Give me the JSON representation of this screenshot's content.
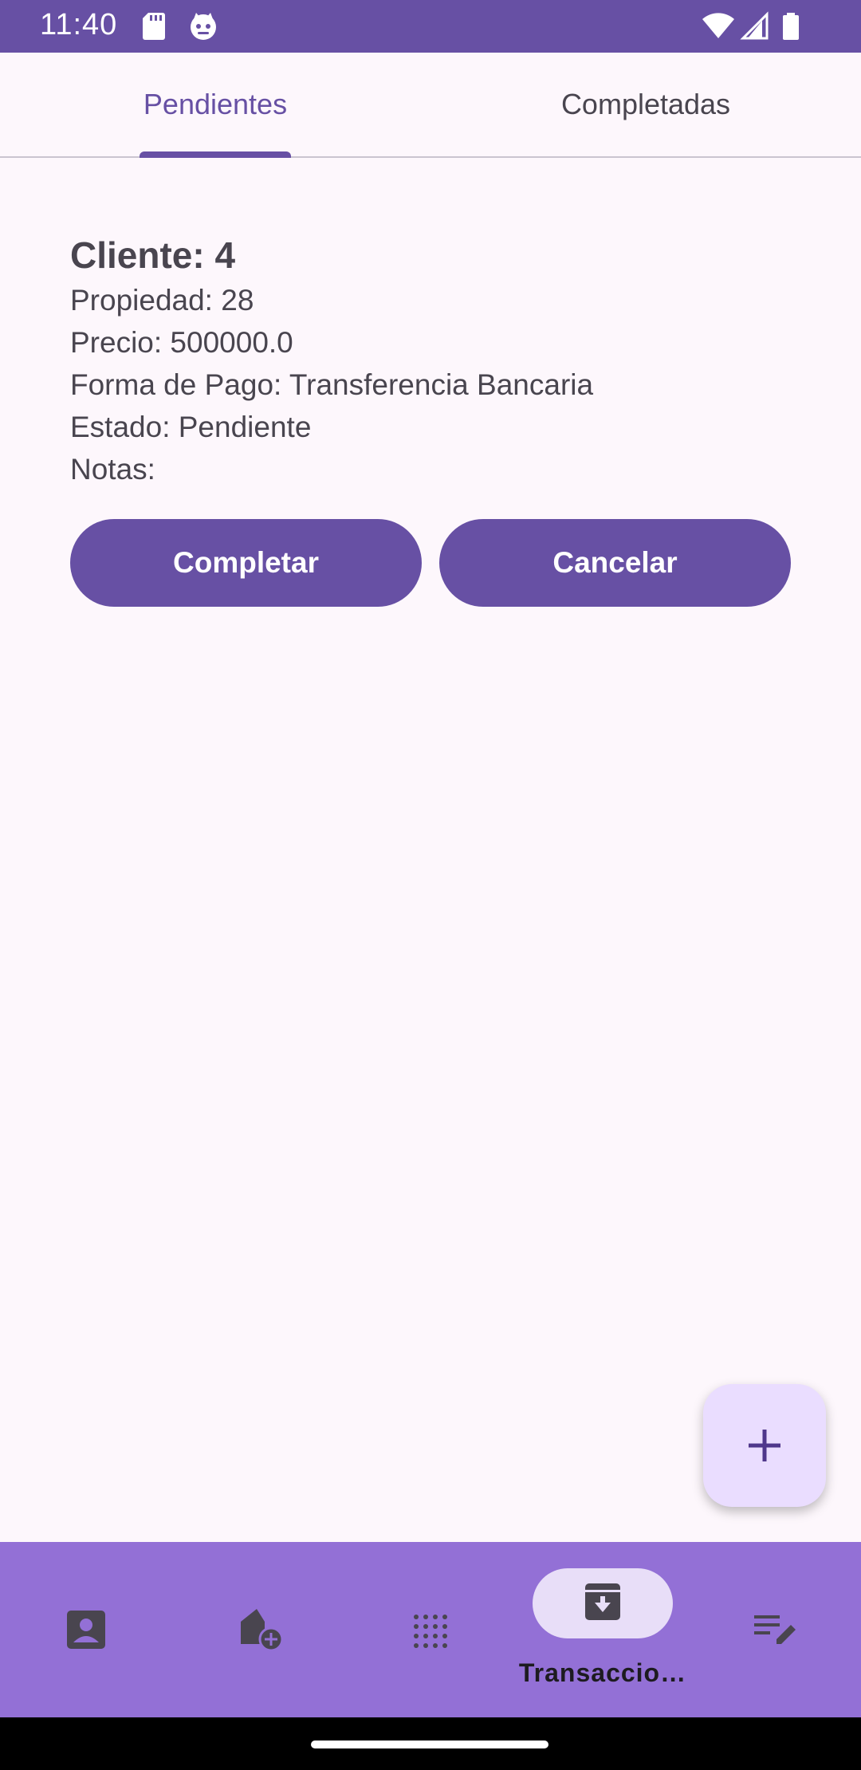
{
  "status_bar": {
    "time": "11:40",
    "icons": [
      "sd-card-icon",
      "cat-icon",
      "wifi-icon",
      "signal-icon",
      "battery-icon"
    ]
  },
  "tabs": [
    {
      "label": "Pendientes",
      "active": true
    },
    {
      "label": "Completadas",
      "active": false
    }
  ],
  "transaction": {
    "title": "Cliente: 4",
    "property": "Propiedad: 28",
    "price": "Precio: 500000.0",
    "payment": "Forma de Pago: Transferencia Bancaria",
    "status": "Estado: Pendiente",
    "notes": "Notas:"
  },
  "actions": {
    "complete_label": "Completar",
    "cancel_label": "Cancelar"
  },
  "fab": {
    "icon": "add-icon"
  },
  "bottom_nav": {
    "items": [
      {
        "icon": "contact-icon"
      },
      {
        "icon": "add-home-icon"
      },
      {
        "icon": "dot-grid-icon"
      },
      {
        "icon": "archive-icon",
        "label": "Transaccio…",
        "active": true
      },
      {
        "icon": "edit-note-icon"
      }
    ]
  },
  "colors": {
    "primary": "#6750A4",
    "nav_background": "#9370D6",
    "fab_background": "#EADDFF",
    "background": "#FDF7FC"
  }
}
